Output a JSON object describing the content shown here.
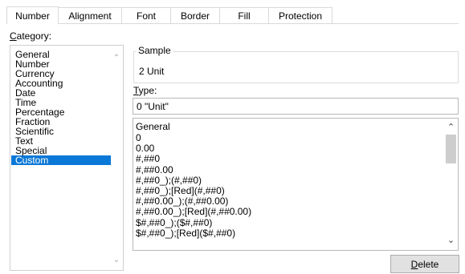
{
  "tabs": [
    {
      "label": "Number",
      "active": true
    },
    {
      "label": "Alignment",
      "active": false
    },
    {
      "label": "Font",
      "active": false
    },
    {
      "label": "Border",
      "active": false
    },
    {
      "label": "Fill",
      "active": false
    },
    {
      "label": "Protection",
      "active": false
    }
  ],
  "category": {
    "label_accel": "C",
    "label_rest": "ategory:",
    "items": [
      "General",
      "Number",
      "Currency",
      "Accounting",
      "Date",
      "Time",
      "Percentage",
      "Fraction",
      "Scientific",
      "Text",
      "Special",
      "Custom"
    ],
    "selected": "Custom"
  },
  "sample": {
    "legend": "Sample",
    "value": "2 Unit"
  },
  "type": {
    "label_accel": "T",
    "label_rest": "ype:",
    "value": "0 \"Unit\""
  },
  "formats": [
    "General",
    "0",
    "0.00",
    "#,##0",
    "#,##0.00",
    "#,##0_);(#,##0)",
    "#,##0_);[Red](#,##0)",
    "#,##0.00_);(#,##0.00)",
    "#,##0.00_);[Red](#,##0.00)",
    "$#,##0_);($#,##0)",
    "$#,##0_);[Red]($#,##0)"
  ],
  "delete_button": {
    "label_accel": "D",
    "label_rest": "elete"
  },
  "colors": {
    "selection": "#0a78d7",
    "border": "#d9d9d9"
  }
}
